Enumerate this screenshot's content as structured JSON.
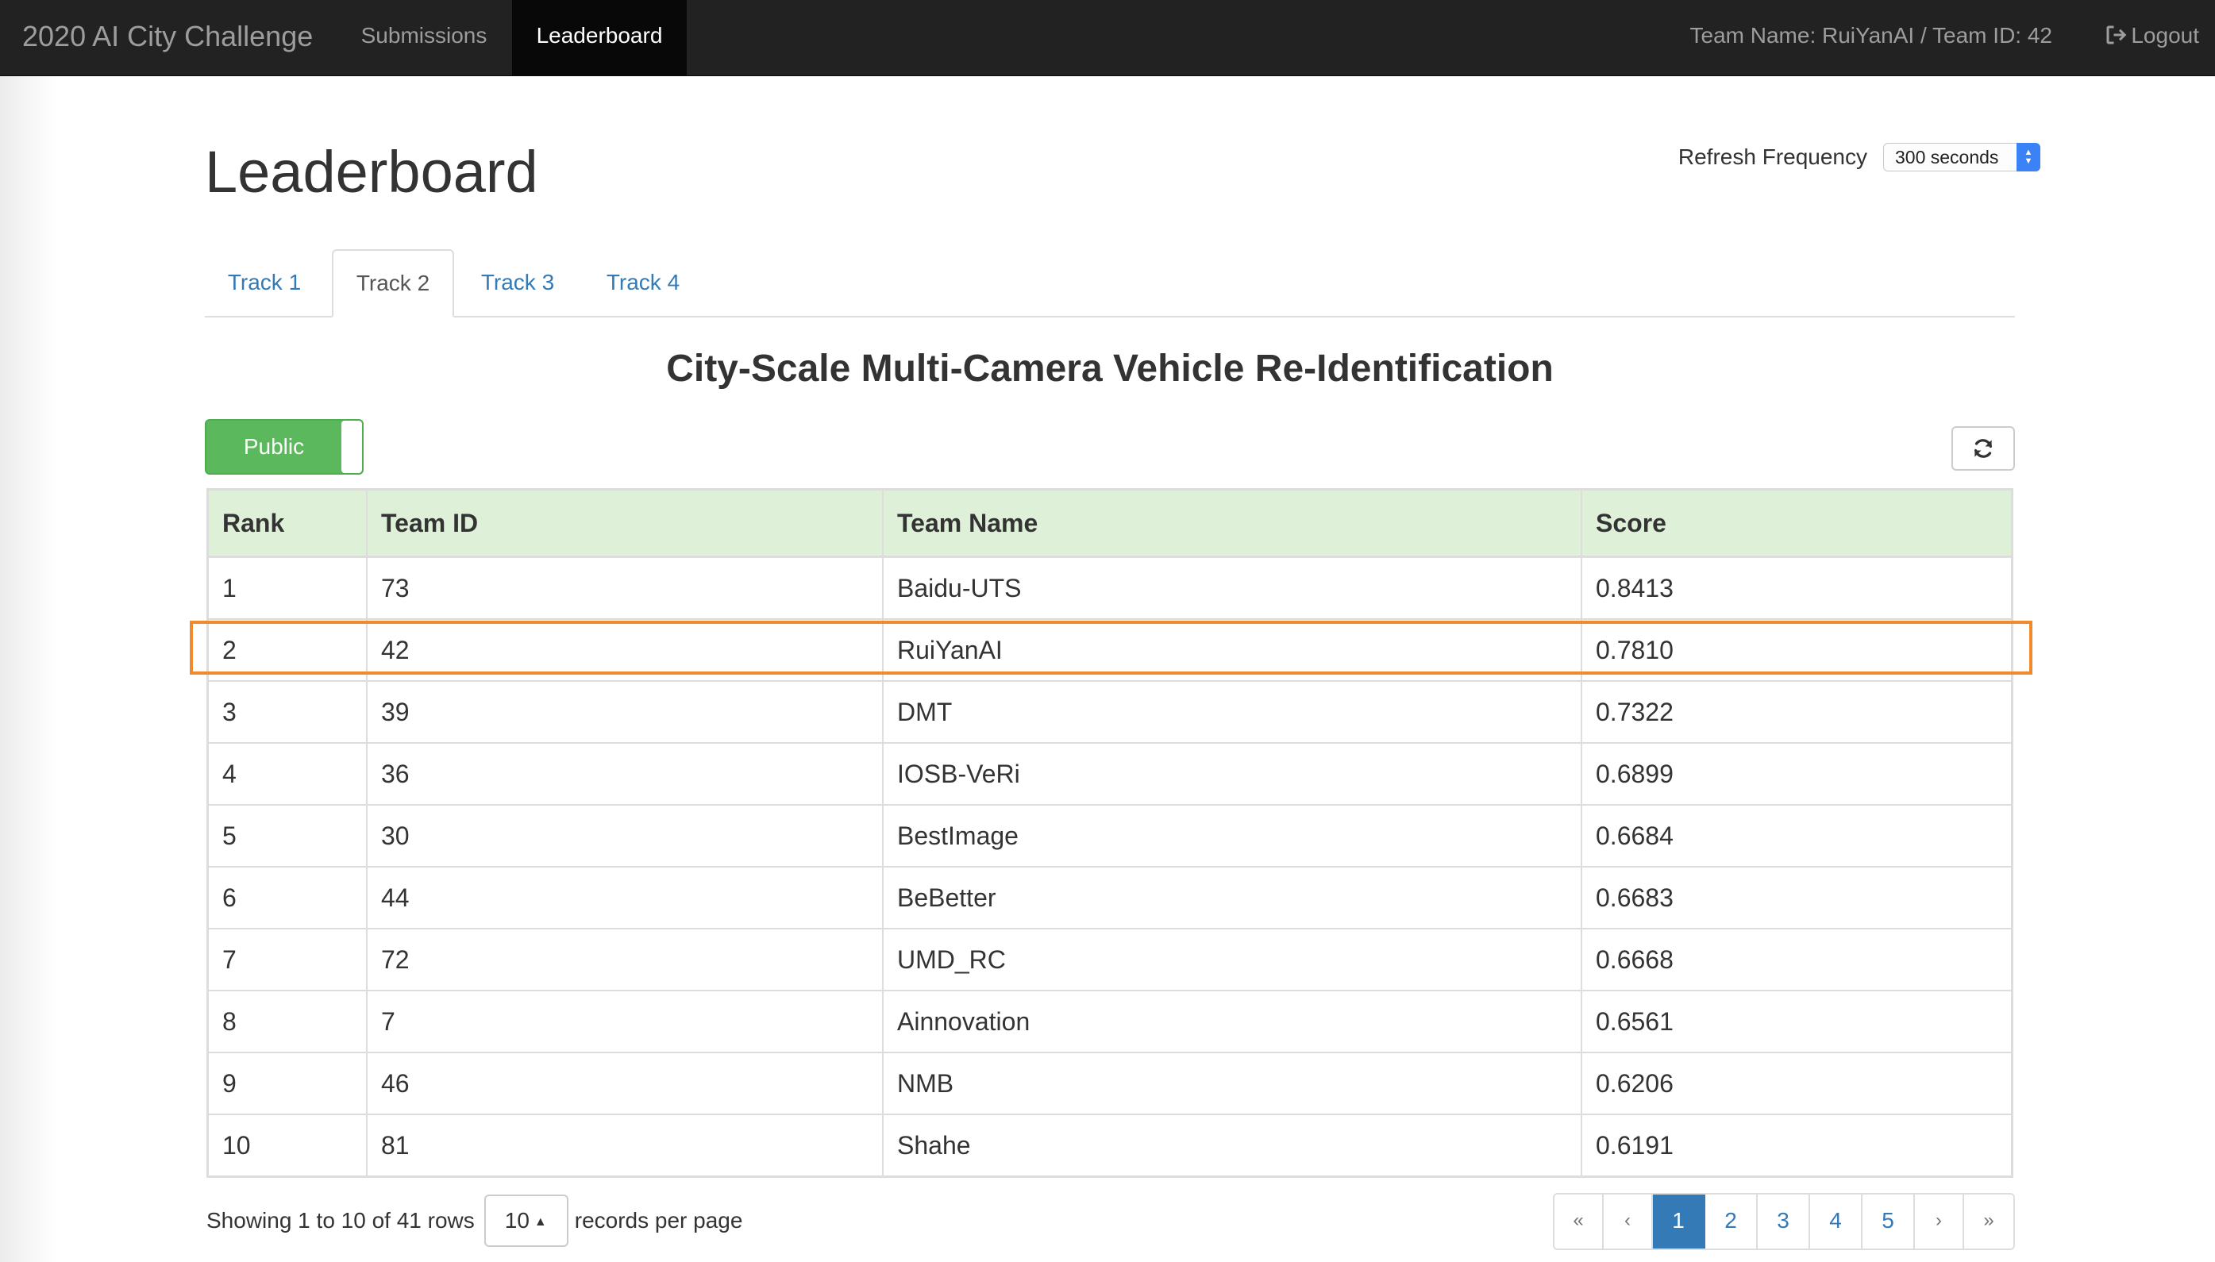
{
  "navbar": {
    "brand": "2020 AI City Challenge",
    "links": [
      {
        "label": "Submissions"
      },
      {
        "label": "Leaderboard",
        "active": true
      }
    ],
    "team_info": "Team Name: RuiYanAI / Team ID: 42",
    "logout_label": "Logout",
    "logout_icon": "logout-icon"
  },
  "page": {
    "title": "Leaderboard",
    "refresh_label": "Refresh Frequency",
    "refresh_value": "300 seconds"
  },
  "tabs": [
    {
      "label": "Track 1"
    },
    {
      "label": "Track 2",
      "active": true
    },
    {
      "label": "Track 3"
    },
    {
      "label": "Track 4"
    }
  ],
  "section_title": "City-Scale Multi-Camera Vehicle Re-Identification",
  "toggle": {
    "label": "Public",
    "color": "#5cb85c"
  },
  "refresh_button_icon": "refresh-icon",
  "table": {
    "columns": [
      "Rank",
      "Team ID",
      "Team Name",
      "Score"
    ],
    "rows": [
      [
        "1",
        "73",
        "Baidu-UTS",
        "0.8413"
      ],
      [
        "2",
        "42",
        "RuiYanAI",
        "0.7810"
      ],
      [
        "3",
        "39",
        "DMT",
        "0.7322"
      ],
      [
        "4",
        "36",
        "IOSB-VeRi",
        "0.6899"
      ],
      [
        "5",
        "30",
        "BestImage",
        "0.6684"
      ],
      [
        "6",
        "44",
        "BeBetter",
        "0.6683"
      ],
      [
        "7",
        "72",
        "UMD_RC",
        "0.6668"
      ],
      [
        "8",
        "7",
        "Ainnovation",
        "0.6561"
      ],
      [
        "9",
        "46",
        "NMB",
        "0.6206"
      ],
      [
        "10",
        "81",
        "Shahe",
        "0.6191"
      ]
    ],
    "highlight_row": 2,
    "highlight_color": "#f08a2e"
  },
  "footer": {
    "showing_text": "Showing 1 to 10 of 41 rows",
    "per_page_value": "10",
    "per_page_suffix": "records per page"
  },
  "pagination": {
    "first": "«",
    "prev": "‹",
    "pages": [
      "1",
      "2",
      "3",
      "4",
      "5"
    ],
    "current": "1",
    "next": "›",
    "last": "»"
  }
}
